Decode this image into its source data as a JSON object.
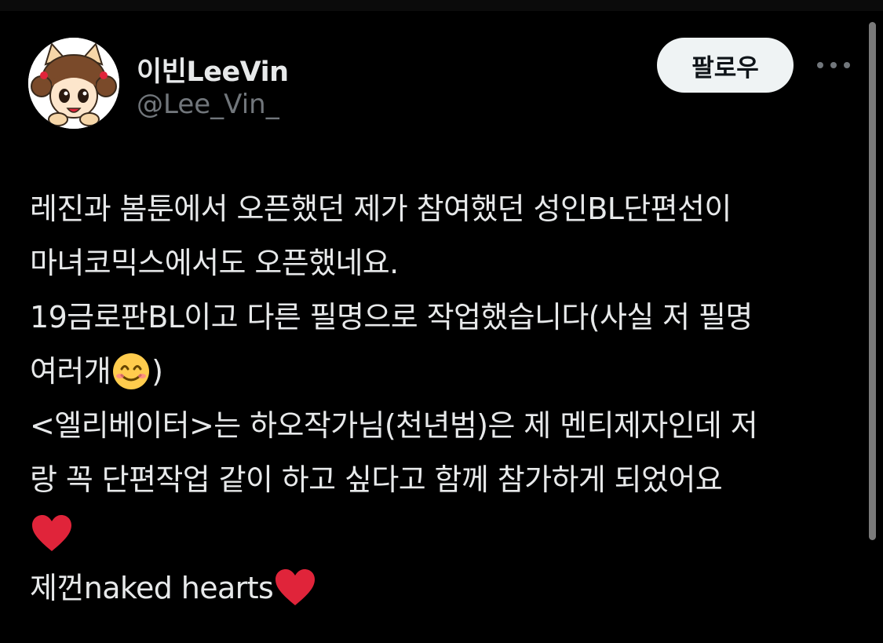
{
  "tweet": {
    "author": {
      "display_name": "이빈LeeVin",
      "handle": "@Lee_Vin_",
      "avatar_icon": "cartoon-cat-girl-avatar"
    },
    "follow_label": "팔로우",
    "more_icon": "more-horizontal-icon",
    "lines": [
      {
        "text": "레진과 봄툰에서 오픈했던 제가 참여했던 성인BL단편선이"
      },
      {
        "text": "마녀코믹스에서도 오픈했네요."
      },
      {
        "text": "19금로판BL이고 다른 필명으로 작업했습니다(사실 저 필명"
      },
      {
        "before": "여러개",
        "emoji": "smiling-face-emoji",
        "after": ")"
      },
      {
        "text": "<엘리베이터>는 하오작가님(천년범)은 제 멘티제자인데 저"
      },
      {
        "text": "랑 꼭 단편작업 같이 하고 싶다고 함께 참가하게 되었어요"
      },
      {
        "before": "",
        "emoji": "red-heart-emoji",
        "after": ""
      },
      {
        "before": "제껀naked hearts",
        "emoji": "red-heart-emoji",
        "after": ""
      }
    ]
  },
  "colors": {
    "background": "#000000",
    "text_primary": "#e7e9ea",
    "text_secondary": "#71767b",
    "follow_button_bg": "#eff3f4",
    "follow_button_text": "#0f1419",
    "heart": "#e0243a",
    "smile_face": "#ffcc4d"
  }
}
